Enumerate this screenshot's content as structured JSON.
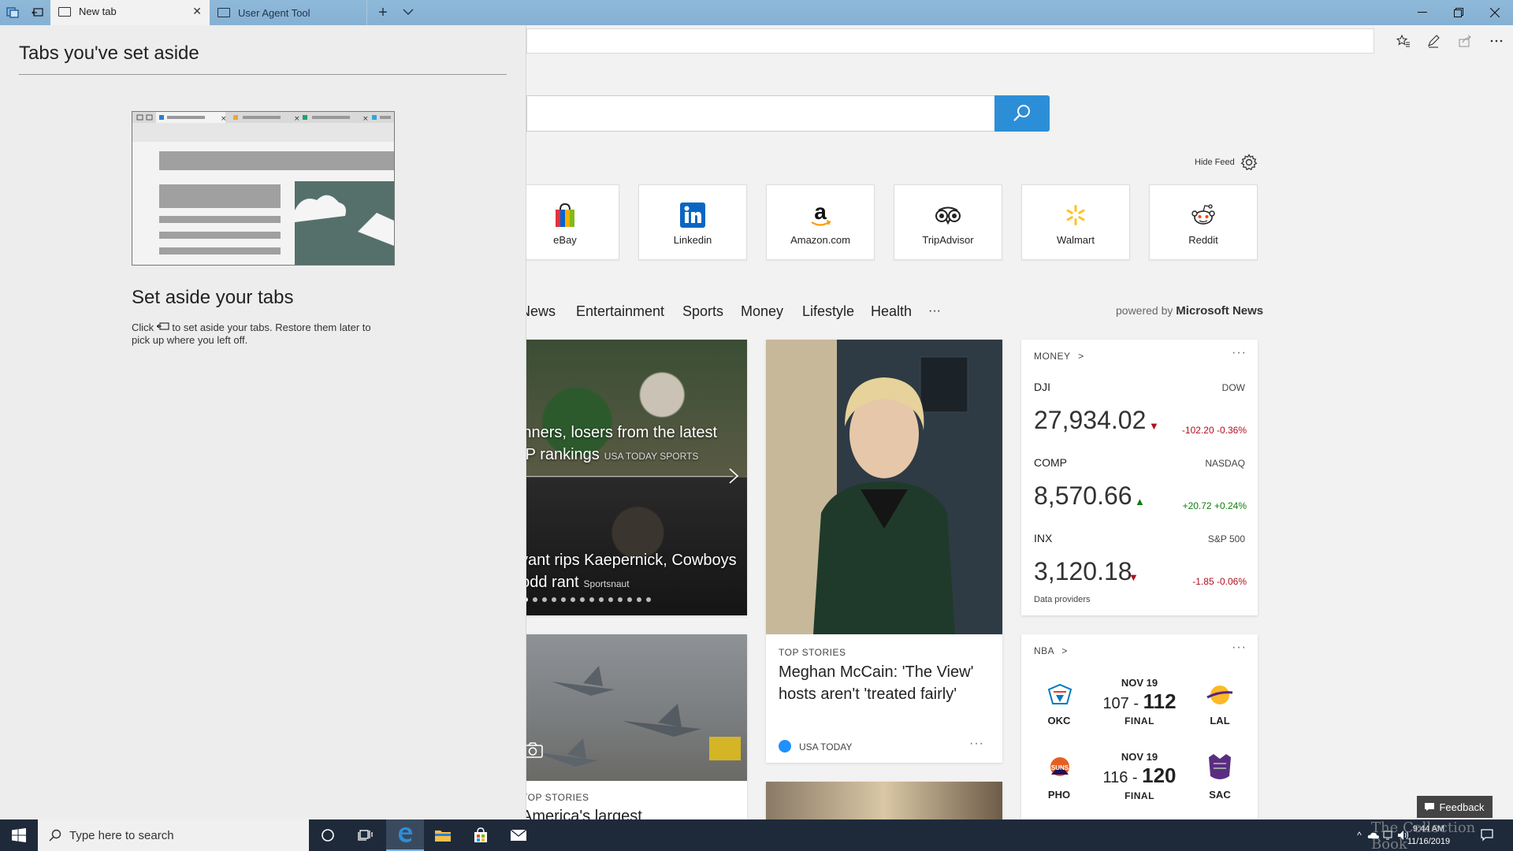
{
  "browser": {
    "tabs": [
      {
        "label": "New tab",
        "active": true
      },
      {
        "label": "User Agent Tool",
        "active": false
      }
    ],
    "new_tab_symbol": "+",
    "close_symbol": "✕"
  },
  "aside_panel": {
    "title": "Tabs you've set aside",
    "heading": "Set aside your tabs",
    "description_before": "Click",
    "description_after": "to set aside your tabs. Restore them later to pick up where you left off."
  },
  "newtab": {
    "hide_feed_label": "Hide Feed",
    "quick_links": [
      {
        "label": "eBay",
        "icon": "ebay-bag-icon"
      },
      {
        "label": "Linkedin",
        "icon": "linkedin-icon"
      },
      {
        "label": "Amazon.com",
        "icon": "amazon-icon"
      },
      {
        "label": "TripAdvisor",
        "icon": "tripadvisor-owl-icon"
      },
      {
        "label": "Walmart",
        "icon": "walmart-spark-icon"
      },
      {
        "label": "Reddit",
        "icon": "reddit-alien-icon"
      }
    ],
    "categories": [
      "News",
      "Entertainment",
      "Sports",
      "Money",
      "Lifestyle",
      "Health",
      "···"
    ],
    "powered_by_prefix": "powered by",
    "powered_by_brand": "Microsoft News"
  },
  "feed": {
    "carousel": {
      "story1_title": "Winners, losers from the latest CFP rankings",
      "story1_source": "USA TODAY SPORTS",
      "story2_title": "Bryant rips Kaepernick, Cowboys in odd rant",
      "story2_source": "Sportsnaut",
      "dots": 14
    },
    "feature_story": {
      "label": "TOP STORIES",
      "title": "Meghan McCain: 'The View' hosts aren't 'treated fairly'",
      "source": "USA TODAY",
      "more": "···"
    },
    "bottom_story": {
      "label": "TOP STORIES",
      "title": "America's largest"
    },
    "money_widget": {
      "label": "MONEY",
      "chevron": ">",
      "more": "···",
      "stocks": [
        {
          "symbol": "DJI",
          "exchange": "DOW",
          "value": "27,934.02",
          "direction": "down",
          "arrow": "▼",
          "change": "-102.20",
          "percent": "-0.36%"
        },
        {
          "symbol": "COMP",
          "exchange": "NASDAQ",
          "value": "8,570.66",
          "direction": "up",
          "arrow": "▲",
          "change": "+20.72",
          "percent": "+0.24%"
        },
        {
          "symbol": "INX",
          "exchange": "S&P 500",
          "value": "3,120.18",
          "direction": "down",
          "arrow": "▼",
          "change": "-1.85",
          "percent": "-0.06%"
        }
      ],
      "providers": "Data providers"
    },
    "nba_widget": {
      "label": "NBA",
      "chevron": ">",
      "more": "···",
      "games": [
        {
          "date": "NOV 19",
          "away": "OKC",
          "home": "LAL",
          "away_score": "107",
          "home_score": "112",
          "status": "FINAL"
        },
        {
          "date": "NOV 19",
          "away": "PHO",
          "home": "SAC",
          "away_score": "116",
          "home_score": "120",
          "status": "FINAL"
        }
      ]
    },
    "feedback_label": "Feedback"
  },
  "taskbar": {
    "search_placeholder": "Type here to search",
    "time": "9:44 AM",
    "date": "11/16/2019"
  },
  "watermark": "The Collection Book",
  "colors": {
    "accent": "#2d8ed8",
    "stock_down": "#b10e1e",
    "stock_up": "#107c10",
    "taskbar": "#1e2a3a"
  }
}
